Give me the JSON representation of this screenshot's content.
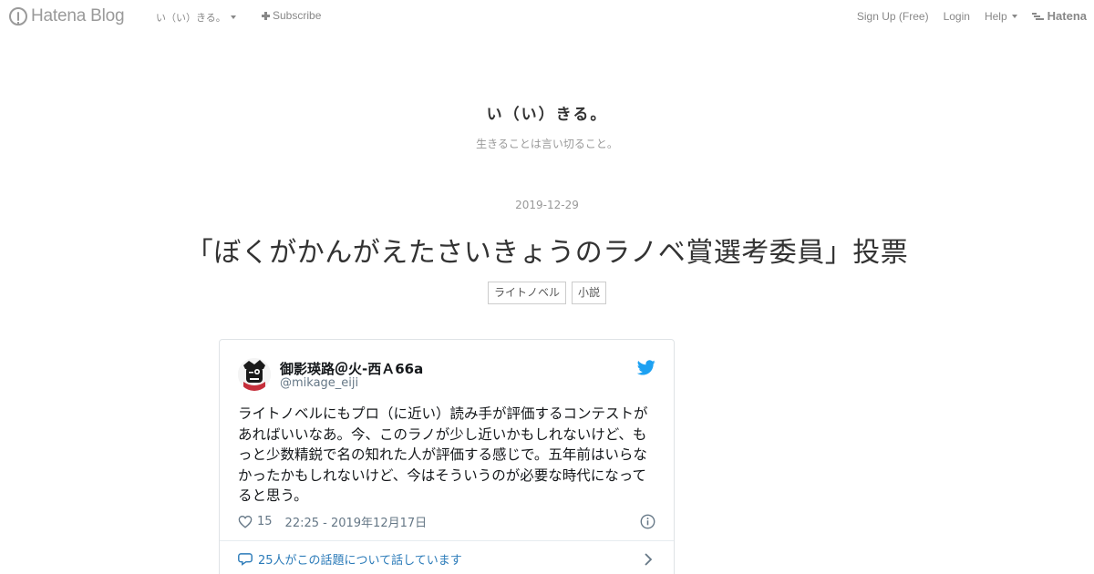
{
  "topbar": {
    "logo_text": "Hatena Blog",
    "blog_selector": "い（い）きる。",
    "subscribe_label": "Subscribe",
    "signup_label": "Sign Up (Free)",
    "login_label": "Login",
    "help_label": "Help",
    "hatena_label": "Hatena",
    "icons": [
      "hatena-blog-logo-icon",
      "chevron-down-icon",
      "plus-icon",
      "hatena-logo-icon"
    ]
  },
  "header": {
    "blog_title": "い（い）きる。",
    "blog_description": "生きることは言い切ること。"
  },
  "entry": {
    "date": "2019-12-29",
    "title": "「ぼくがかんがえたさいきょうのラノベ賞選考委員」投票",
    "categories": [
      "ライトノベル",
      "小説"
    ]
  },
  "tweet": {
    "author_name": "御影瑛路＠火-西Ａ66a",
    "author_handle": "@mikage_eiji",
    "text": "ライトノベルにもプロ（に近い）読み手が評価するコンテストがあればいいなあ。今、このラノが少し近いかもしれないけど、もっと少数精鋭で名の知れた人が評価する感じで。五年前はいらなかったかもしれないけど、今はそういうのが必要な時代になってると思う。",
    "likes": "15",
    "timestamp": "22:25 - 2019年12月17日",
    "reply_link": "25人がこの話題について話しています",
    "colors": {
      "link": "#2b7bb9",
      "twitter_blue": "#1da1f2",
      "muted": "#657786"
    },
    "icons": [
      "twitter-bird-icon",
      "heart-icon",
      "info-icon",
      "speech-bubble-icon",
      "chevron-right-icon"
    ]
  }
}
